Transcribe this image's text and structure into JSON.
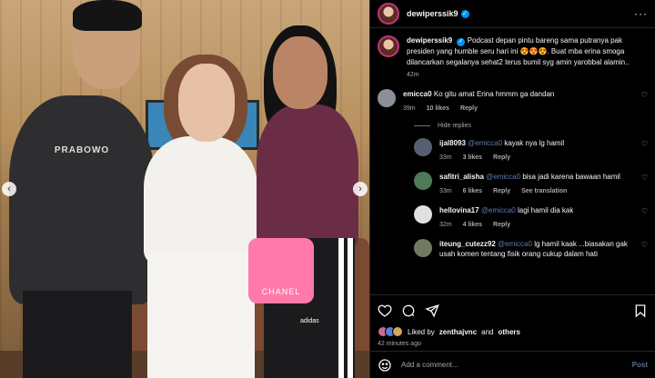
{
  "post": {
    "username": "dewiperssik9",
    "caption": "Podcast depan pintu bareng sama putranya pak presiden yang humble seru hari ini 😍😍😍. Buat mba erina smoga dilancarkan segalanya sehat2 terus bumil syg amin yarobbal alamin..",
    "caption_time": "42m",
    "photo": {
      "tshirt_text": "PRABOWO",
      "bag_text": "CHANEL",
      "brand_text": "adidas"
    }
  },
  "comments": [
    {
      "user": "emicca0",
      "text": "Ko gitu amat Erina hmmm ga dandan",
      "time": "39m",
      "likes": "10 likes",
      "reply": "Reply",
      "avatar_color": "#8a8f99"
    }
  ],
  "hide_replies": "Hide replies",
  "replies": [
    {
      "user": "ijal8093",
      "mention": "@emicca0",
      "text": "kayak nya lg hamil",
      "time": "33m",
      "likes": "3 likes",
      "reply": "Reply",
      "extra": "",
      "avatar_color": "#556070"
    },
    {
      "user": "safitri_alisha",
      "mention": "@emicca0",
      "text": "bisa jadi karena bawaan hamil",
      "time": "33m",
      "likes": "6 likes",
      "reply": "Reply",
      "extra": "See translation",
      "avatar_color": "#4f7a5a"
    },
    {
      "user": "hellovina17",
      "mention": "@emicca0",
      "text": "lagi hamil dia kak",
      "time": "32m",
      "likes": "4 likes",
      "reply": "Reply",
      "extra": "",
      "avatar_color": "#e0e0e0"
    },
    {
      "user": "iteung_cutezz92",
      "mention": "@emicca0",
      "text": "lg hamil kaak ...biasakan gak usah komen tentang fisik orang cukup dalam hati",
      "time": "",
      "likes": "",
      "reply": "",
      "extra": "",
      "avatar_color": "#6f7a5f"
    }
  ],
  "likes_line": {
    "prefix": "Liked by",
    "user": "zenthajvnc",
    "and": "and",
    "others": "others"
  },
  "post_time": "42 minutes ago",
  "add_comment": {
    "placeholder": "Add a comment...",
    "post_label": "Post"
  },
  "colors": {
    "background": "#000000",
    "verified": "#0095f6",
    "mention": "#5c7cb0",
    "muted": "#a8a8a8"
  }
}
